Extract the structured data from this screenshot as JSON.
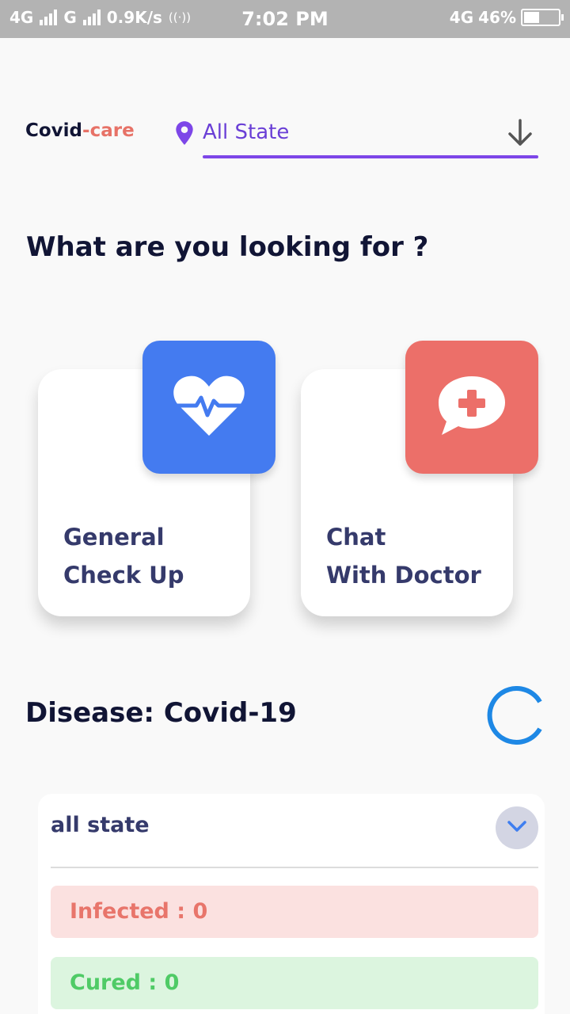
{
  "status_bar": {
    "network_1": "4G",
    "network_2": "G",
    "speed": "0.9K/s",
    "hotspot": "((·))",
    "time": "7:02 PM",
    "network_right": "4G",
    "battery": "46%"
  },
  "header": {
    "brand_main": "Covid",
    "brand_accent": "-care",
    "state_label": "All State",
    "icons": {
      "location": "location-pin-icon",
      "dropdown": "arrow-down-icon"
    }
  },
  "question": "What are you looking for ?",
  "cards": [
    {
      "line1": "General",
      "line2": "Check Up",
      "icon": "heart-pulse-icon",
      "color": "#447bf0"
    },
    {
      "line1": "Chat",
      "line2": "With Doctor",
      "icon": "medical-chat-icon",
      "color": "#ec6f69"
    }
  ],
  "disease": {
    "title": "Disease: Covid-19",
    "loading": true
  },
  "stats_panel": {
    "selected_state": "all state",
    "infected": "Infected : 0",
    "cured": "Cured : 0"
  },
  "colors": {
    "primary_text": "#111535",
    "accent_purple": "#7d46e8",
    "accent_red": "#e77267",
    "blue": "#447bf0"
  }
}
